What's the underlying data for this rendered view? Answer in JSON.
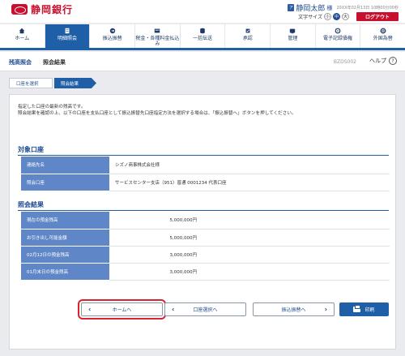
{
  "bank": {
    "name": "静岡銀行"
  },
  "user": {
    "icon_label": "ア",
    "name": "静岡太郎",
    "suffix": "様",
    "last_login": "20XX年02月13日 10時00分00秒"
  },
  "font_size": {
    "label": "文字サイズ",
    "small": "小",
    "medium": "中",
    "large": "大"
  },
  "logout_label": "ログアウト",
  "nav": [
    {
      "label": "ホーム",
      "icon": "home-icon"
    },
    {
      "label": "明細照会",
      "icon": "document-icon"
    },
    {
      "label": "振込振替",
      "icon": "transfer-icon"
    },
    {
      "label": "税金・各種料金払込み",
      "icon": "tax-icon"
    },
    {
      "label": "一括伝送",
      "icon": "batch-icon"
    },
    {
      "label": "承認",
      "icon": "approve-icon"
    },
    {
      "label": "管理",
      "icon": "manage-icon"
    },
    {
      "label": "電子記録債権",
      "icon": "bond-icon"
    },
    {
      "label": "外国為替",
      "icon": "forex-icon"
    }
  ],
  "page": {
    "category": "残高照会",
    "title": "照会結果",
    "screen_id": "BZDS002",
    "help_label": "ヘルプ",
    "help_icon_label": "?"
  },
  "steps": {
    "step1": "口座を選択",
    "step2": "照会結果"
  },
  "intro": {
    "line1": "指定した口座の最新の残高です。",
    "line2": "照会結果を確認の上、以下の口座を支払口座として振込振替先口座指定方法を選択する場合は、「振込振替へ」ボタンを押してください。"
  },
  "account_section": {
    "title": "対象口座",
    "rows": [
      {
        "label": "連絡先名",
        "value": "シズノ商事株式会社様"
      },
      {
        "label": "照会口座",
        "value": "サービスセンター支店（951）普通 0001234 代表口座"
      }
    ]
  },
  "result_section": {
    "title": "照会結果",
    "rows": [
      {
        "label": "現在の預金残高",
        "value": "5,000,000円"
      },
      {
        "label": "お引き出し可能金額",
        "value": "5,000,000円"
      },
      {
        "label": "02月12日の預金残高",
        "value": "3,000,000円"
      },
      {
        "label": "01月末日の預金残高",
        "value": "3,000,000円"
      }
    ]
  },
  "buttons": {
    "home": "ホームへ",
    "select_account": "口座選択へ",
    "transfer": "振込振替へ",
    "print": "印刷",
    "prev_glyph": "‹",
    "next_glyph": "›"
  }
}
